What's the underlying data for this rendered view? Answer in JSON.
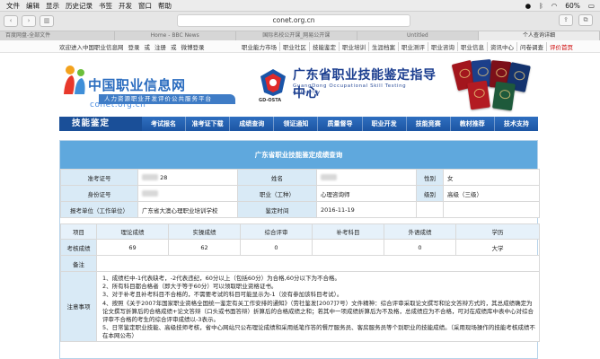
{
  "menubar": {
    "items": [
      "文件",
      "编辑",
      "显示",
      "历史记录",
      "书签",
      "开发",
      "窗口",
      "帮助"
    ],
    "battery": "60%"
  },
  "toolbar": {
    "url": "conet.org.cn"
  },
  "tabs": [
    "百度网盘-全部文件",
    "Home - BBC News",
    "国际名校公开课_网易公开课",
    "Untitled",
    "个人查询详细"
  ],
  "topline": {
    "welcome": "欢迎进入中国职业信息网",
    "login": "登录",
    "or": "或",
    "register": "注册",
    "or2": "或",
    "weibo": "微博登录",
    "nav_links": [
      "职业能力市场",
      "职业社区",
      "技能鉴定",
      "职业培训",
      "生涯档案",
      "职业测评",
      "职业咨询",
      "职业信息",
      "资讯中心",
      "问卷调查",
      "评价首页"
    ]
  },
  "banner": {
    "logo_title": "中国职业信息网",
    "logo_domain": "conet.org.cn",
    "logo_sub": "人力资源职业开发评价公共服务平台",
    "gd_abbr": "GD-OSTA",
    "gd_cn": "广东省职业技能鉴定指导中心",
    "gd_en1": "GuangDong Occupational Skill Testing",
    "gd_en2": "Authority"
  },
  "mainnav": {
    "brand": "技能鉴定",
    "items": [
      "考试报名",
      "准考证下载",
      "成绩查询",
      "领证通知",
      "质量督导",
      "职业开发",
      "技能竞赛",
      "教材推荐",
      "技术支持"
    ]
  },
  "panel": {
    "title": "广东省职业技能鉴定成绩查询",
    "rows": [
      {
        "l1": "准考证号",
        "v1": "28",
        "l2": "姓名",
        "v2": "",
        "l3": "性别",
        "v3": "女"
      },
      {
        "l1": "身份证号",
        "v1": "",
        "l2": "职业（工种）",
        "v2": "心理咨询师",
        "l3": "级别",
        "v3": "高级（三级）"
      },
      {
        "l1": "报考单位（工作单位）",
        "v1": "广东省大澳心理职业培训学校",
        "l2": "鉴定时间",
        "v2": "2016-11-19",
        "l3": "",
        "v3": ""
      }
    ],
    "grade_headers": [
      "项目",
      "理论成绩",
      "实操成绩",
      "综合评审",
      "补考科目",
      "外语成绩",
      "学历"
    ],
    "grade_row": [
      "考核成绩",
      "69",
      "62",
      "0",
      "",
      "0",
      "大学"
    ],
    "remark_label": "备注",
    "remark_value": "",
    "notes_label": "注意事项",
    "notes": [
      "1、成绩栏中-1代表缺考，-2代表违纪，60分以上（包括60分）为合格,60分以下为不合格。",
      "2、所有科目都合格者（即大于等于60分）可以领取职业资格证书。",
      "3、对于补考且补考科目不合格的，不需要考试的科目可能显示为-1（没有参加该科目考试）。",
      "4、按照《关于2007年国家职业资格全国统一鉴定有关工作安排的通知》（劳社鉴发[2007]7号）文件精神：综合评审采取论文撰写和论文答辩方式的，其总成绩确定为论文撰写折算后的合格成绩+论文答辩（口头或书面答辩）折算后的合格成绩之和；若其中一项成绩折算后为不及格，总成绩应为不合格，可对在成绩库中表中心对综合评审不合格的考生的综合评审成绩以-3表示。",
      "5、日常鉴定职业技能、高级技师考核，省中心网站只公布理论成绩和采用纸笔作答的餐厅服务员、客房服务员等个别职业的技能成绩。（采用现场操作的技能考核成绩不在本网公布）"
    ]
  }
}
